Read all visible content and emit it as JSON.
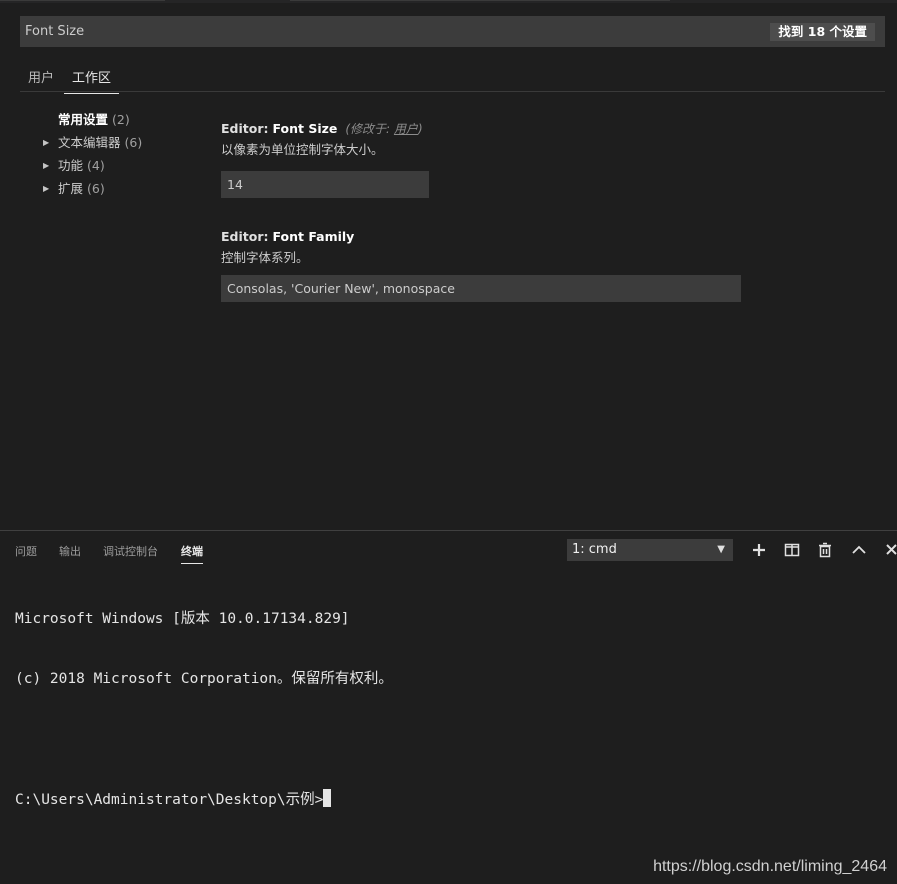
{
  "search": {
    "query": "Font Size",
    "result_count": "找到 18 个设置"
  },
  "tabs": {
    "user": "用户",
    "workspace": "工作区"
  },
  "toc": [
    {
      "label": "常用设置",
      "count": "(2)",
      "expandable": false
    },
    {
      "label": "文本编辑器",
      "count": "(6)",
      "expandable": true
    },
    {
      "label": "功能",
      "count": "(4)",
      "expandable": true
    },
    {
      "label": "扩展",
      "count": "(6)",
      "expandable": true
    }
  ],
  "settings": {
    "font_size": {
      "category": "Editor:",
      "key": "Font Size",
      "modified_prefix": "(修改于:",
      "modified_target": "用户",
      "modified_suffix": ")",
      "description": "以像素为单位控制字体大小。",
      "value": "14"
    },
    "font_family": {
      "category": "Editor:",
      "key": "Font Family",
      "description": "控制字体系列。",
      "value": "Consolas, 'Courier New', monospace"
    }
  },
  "panel": {
    "tabs": [
      "问题",
      "输出",
      "调试控制台",
      "终端"
    ],
    "active_tab": "终端",
    "terminal_select": "1: cmd",
    "icons": [
      "plus-icon",
      "split-icon",
      "trash-icon",
      "chevron-up-icon",
      "close-icon"
    ]
  },
  "terminal": {
    "lines": [
      "Microsoft Windows [版本 10.0.17134.829]",
      "(c) 2018 Microsoft Corporation。保留所有权利。",
      "",
      "C:\\Users\\Administrator\\Desktop\\示例>"
    ]
  },
  "watermark": "https://blog.csdn.net/liming_2464",
  "colors": {
    "background": "#1e1e1e",
    "input_background": "#3c3c3c",
    "foreground": "#cccccc"
  }
}
